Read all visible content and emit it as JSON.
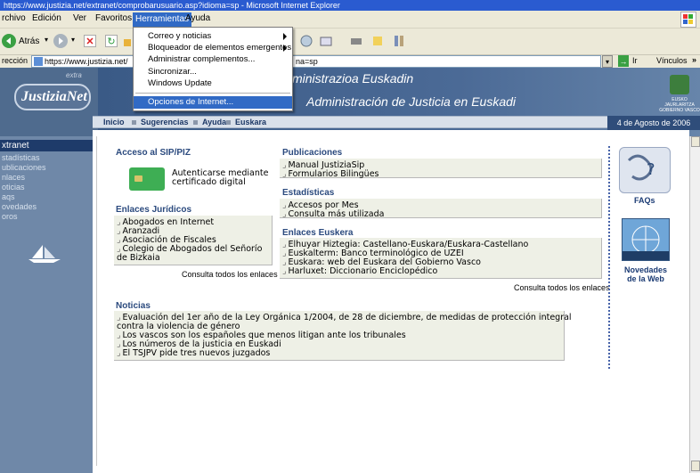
{
  "window": {
    "title": "https://www.justizia.net/extranet/comprobarusuario.asp?idioma=sp - Microsoft Internet Explorer"
  },
  "menubar": {
    "items": [
      "rchivo",
      "Edición",
      "Ver",
      "Favoritos",
      "Herramientas",
      "Ayuda"
    ]
  },
  "toolbar": {
    "back_label": "Atrás"
  },
  "address": {
    "label": "rección",
    "url_left": "https://www.justizia.net/",
    "url_right": "na=sp",
    "go_label": "Ir",
    "links_label": "Vínculos"
  },
  "tools_menu": {
    "items": [
      "Correo y noticias",
      "Bloqueador de elementos emergentes",
      "Administrar complementos...",
      "Sincronizar...",
      "Windows Update",
      "Opciones de Internet..."
    ]
  },
  "header": {
    "logo": "JustiziaNet",
    "logo_extra": "extra",
    "title1": "ministrazioa Euskadin",
    "title2": "Administración de Justicia en Euskadi",
    "crest_text": "EUSKO JAURLARITZA GOBIERNO VASCO"
  },
  "nav": {
    "items": [
      "Inicio",
      "Sugerencias",
      "Ayuda",
      "Euskara"
    ],
    "date": "4 de Agosto de 2006"
  },
  "sidebar": {
    "items": [
      "xtranet",
      "stadísticas",
      "ublicaciones",
      "nlaces",
      "oticias",
      "aqs",
      "ovedades",
      "oros"
    ]
  },
  "sections": {
    "acceso": {
      "title": "Acceso al SIP/PIZ",
      "text1": "Autenticarse mediante",
      "text2": "certificado digital"
    },
    "juridicos": {
      "title": "Enlaces Jurídicos",
      "items": [
        "Abogados en Internet",
        "Aranzadi",
        "Asociación de Fiscales",
        "Colegio de Abogados del Señorío",
        "de Bizkaia"
      ],
      "more": "Consulta todos los enlaces"
    },
    "publicaciones": {
      "title": "Publicaciones",
      "items": [
        "Manual JustiziaSip",
        "Formularios Bilingües"
      ]
    },
    "estadisticas": {
      "title": "Estadísticas",
      "items": [
        "Accesos por Mes",
        "Consulta más utilizada"
      ]
    },
    "euskera": {
      "title": "Enlaces Euskera",
      "items": [
        "Elhuyar Hiztegia: Castellano-Euskara/Euskara-Castellano",
        "Euskalterm: Banco terminológico de UZEI",
        "Euskara: web del Euskara del Gobierno Vasco",
        "Harluxet: Diccionario Enciclopédico"
      ],
      "more": "Consulta todos los enlaces"
    },
    "noticias": {
      "title": "Noticias",
      "items": [
        "Evaluación del 1er año de la Ley Orgánica 1/2004, de 28 de diciembre, de medidas de protección integral",
        "contra la violencia de género",
        "Los vascos son los españoles que menos litigan ante los tribunales",
        "Los números de la justicia en Euskadi",
        "El TSJPV pide tres nuevos juzgados"
      ]
    },
    "right": {
      "faqs": "FAQs",
      "novedades1": "Novedades",
      "novedades2": "de la Web"
    }
  }
}
